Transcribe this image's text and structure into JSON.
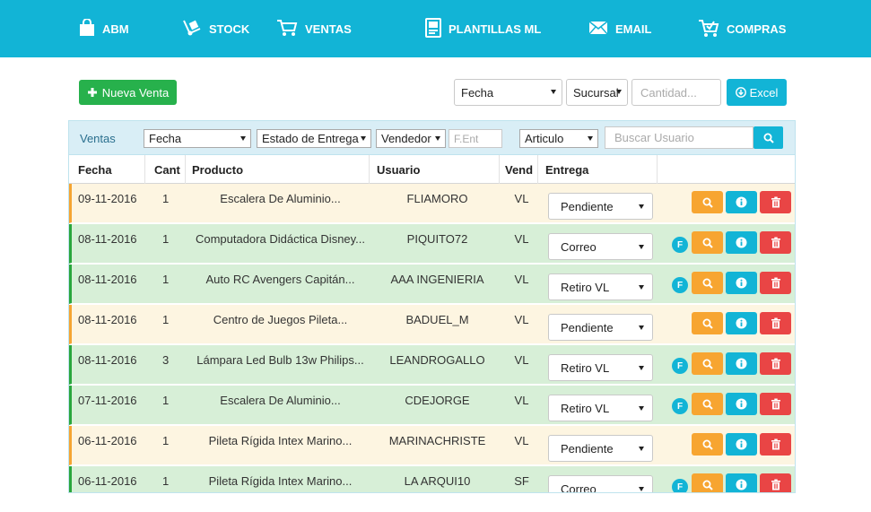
{
  "nav": [
    {
      "label": "ABM",
      "icon": "shopping-bag-icon"
    },
    {
      "label": "STOCK",
      "icon": "dolly-icon"
    },
    {
      "label": "VENTAS",
      "icon": "cart-icon"
    },
    {
      "label": "PLANTILLAS ML",
      "icon": "template-icon"
    },
    {
      "label": "EMAIL",
      "icon": "envelope-icon"
    },
    {
      "label": "COMPRAS",
      "icon": "cart-check-icon"
    }
  ],
  "toolbar": {
    "new_sale_label": "Nueva Venta",
    "date_select": "Fecha",
    "branch_select": "Sucursal",
    "quantity_placeholder": "Cantidad...",
    "excel_label": "Excel"
  },
  "filters": {
    "title": "Ventas",
    "date_select": "Fecha",
    "delivery_status_select": "Estado de Entrega",
    "seller_select": "Vendedor",
    "delivery_date_placeholder": "F.Ent",
    "article_select": "Articulo",
    "user_search_placeholder": "Buscar Usuario"
  },
  "columns": [
    "Fecha",
    "Cant",
    "Producto",
    "Usuario",
    "Vend",
    "Entrega"
  ],
  "rows": [
    {
      "fecha": "09-11-2016",
      "cant": "1",
      "producto": "Escalera De Aluminio...",
      "usuario": "FLIAMORO",
      "vend": "VL",
      "entrega": "Pendiente",
      "status": "pending",
      "invoice": false
    },
    {
      "fecha": "08-11-2016",
      "cant": "1",
      "producto": "Computadora Didáctica Disney...",
      "usuario": "PIQUITO72",
      "vend": "VL",
      "entrega": "Correo",
      "status": "done",
      "invoice": true
    },
    {
      "fecha": "08-11-2016",
      "cant": "1",
      "producto": "Auto RC Avengers Capitán...",
      "usuario": "AAA INGENIERIA",
      "vend": "VL",
      "entrega": "Retiro VL",
      "status": "done",
      "invoice": true
    },
    {
      "fecha": "08-11-2016",
      "cant": "1",
      "producto": "Centro de Juegos Pileta...",
      "usuario": "BADUEL_M",
      "vend": "VL",
      "entrega": "Pendiente",
      "status": "pending",
      "invoice": false
    },
    {
      "fecha": "08-11-2016",
      "cant": "3",
      "producto": "Lámpara Led Bulb 13w Philips...",
      "usuario": "LEANDROGALLO",
      "vend": "VL",
      "entrega": "Retiro VL",
      "status": "done",
      "invoice": true
    },
    {
      "fecha": "07-11-2016",
      "cant": "1",
      "producto": "Escalera De Aluminio...",
      "usuario": "CDEJORGE",
      "vend": "VL",
      "entrega": "Retiro VL",
      "status": "done",
      "invoice": true
    },
    {
      "fecha": "06-11-2016",
      "cant": "1",
      "producto": "Pileta Rígida Intex Marino...",
      "usuario": "MARINACHRISTE",
      "vend": "VL",
      "entrega": "Pendiente",
      "status": "pending",
      "invoice": false
    },
    {
      "fecha": "06-11-2016",
      "cant": "1",
      "producto": "Pileta Rígida Intex Marino...",
      "usuario": "LA ARQUI10",
      "vend": "SF",
      "entrega": "Correo",
      "status": "done",
      "invoice": true
    }
  ],
  "invoice_badge": "F",
  "colors": {
    "nav_bg": "#12b4d6",
    "primary_green": "#27b14c",
    "pending_row": "#fdf5e1",
    "pending_accent": "#f5a532",
    "done_row": "#d7efd7",
    "done_accent": "#29a63c",
    "search_btn": "#f7a531",
    "info_btn": "#12b4d6",
    "delete_btn": "#e94545"
  }
}
